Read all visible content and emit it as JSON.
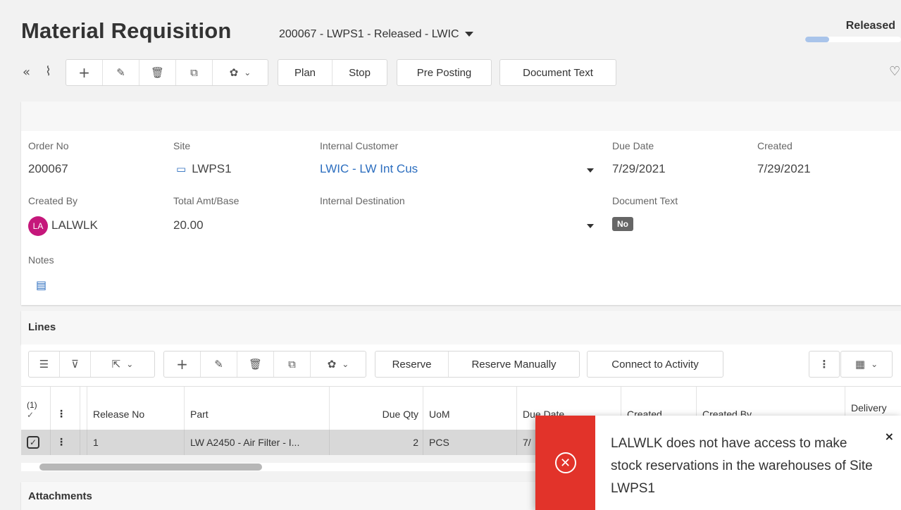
{
  "header": {
    "title": "Material Requisition",
    "subtitle": "200067 - LWPS1 - Released - LWIC",
    "state": "Released",
    "state_progress": 0.25
  },
  "toolbar": {
    "collapse_icon": "double-chevron-left-icon",
    "attach_icon": "paperclip-icon",
    "plan_label": "Plan",
    "stop_label": "Stop",
    "pre_posting_label": "Pre Posting",
    "document_text_label": "Document Text"
  },
  "form": {
    "order_no_label": "Order No",
    "order_no": "200067",
    "site_label": "Site",
    "site": "LWPS1",
    "internal_customer_label": "Internal Customer",
    "internal_customer": "LWIC - LW Int Cus",
    "due_date_label": "Due Date",
    "due_date": "7/29/2021",
    "created_label": "Created",
    "created": "7/29/2021",
    "created_by_label": "Created By",
    "created_by_initials": "LA",
    "created_by": "LALWLK",
    "total_amt_label": "Total Amt/Base",
    "total_amt": "20.00",
    "internal_destination_label": "Internal Destination",
    "document_text_label": "Document Text",
    "document_text_value": "No",
    "notes_label": "Notes"
  },
  "lines": {
    "title": "Lines",
    "reserve_label": "Reserve",
    "reserve_manually_label": "Reserve Manually",
    "connect_label": "Connect to Activity",
    "columns": {
      "selected_count": "(1)",
      "release_no": "Release No",
      "part": "Part",
      "due_qty": "Due Qty",
      "uom": "UoM",
      "due_date": "Due Date",
      "created": "Created",
      "created_by": "Created By",
      "delivery_date": "Delivery Date"
    },
    "rows": [
      {
        "release_no": "1",
        "part": "LW A2450 - Air Filter - I...",
        "due_qty": "2",
        "uom": "PCS",
        "due_date": "7/"
      }
    ]
  },
  "attachments": {
    "title": "Attachments"
  },
  "toast": {
    "message": "LALWLK does not have access to make stock reservations in the warehouses of Site LWPS1",
    "close": "×"
  },
  "colors": {
    "accent_link": "#2c6ebf",
    "error": "#e2332a",
    "avatar": "#c5177b"
  }
}
